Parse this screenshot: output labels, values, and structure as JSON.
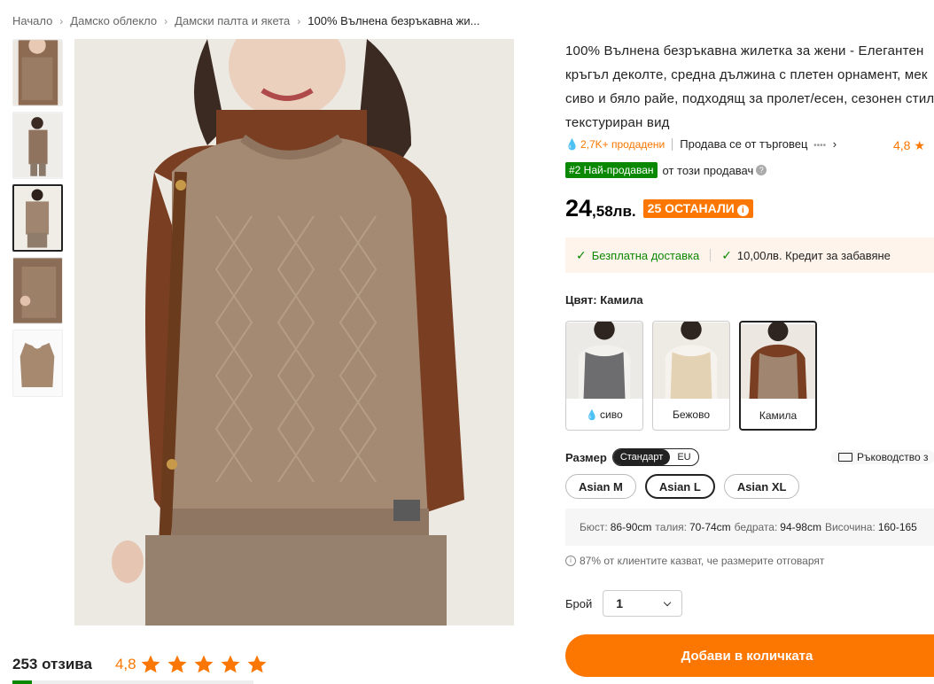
{
  "breadcrumb": [
    "Начало",
    "Дамско облекло",
    "Дамски палта и якета",
    "100% Вълнена безръкавна жи..."
  ],
  "product": {
    "title": "100% Вълнена безръкавна жилетка за жени - Елегантен кръгъл деколте, средна дължина с плетен орнамент, мек сиво и бяло райе, подходящ за пролет/есен, сезонен стил текстуриран вид",
    "sold": "2,7K+ продадени",
    "seller": "Продава се от търговец",
    "seller_masked": "••••",
    "rating_top": "4,8",
    "best_badge": "#2 Най-продаван",
    "best_text": "от този продавач",
    "price_int": "24",
    "price_dec": ",58лв.",
    "stock_badge": "25 ОСТАНАЛИ",
    "shipping_free": "Безплатна доставка",
    "credit": "10,00лв. Кредит за забавяне",
    "color_label": "Цвят: Камила",
    "colors": [
      {
        "label": "сиво",
        "hot": true
      },
      {
        "label": "Бежово",
        "hot": false
      },
      {
        "label": "Камила",
        "hot": false
      }
    ],
    "size_label": "Размер",
    "size_toggle": [
      "Стандарт",
      "EU"
    ],
    "size_guide": "Ръководство з",
    "sizes": [
      "Asian M",
      "Asian L",
      "Asian XL"
    ],
    "measure": {
      "bust_label": "Бюст:",
      "bust": "86-90cm",
      "waist_label": "талия:",
      "waist": "70-74cm",
      "hips_label": "бедрата:",
      "hips": "94-98cm",
      "height_label": "Височина:",
      "height": "160-165"
    },
    "fit_text": "87% от клиентите казват, че размерите отговарят",
    "qty_label": "Брой",
    "qty_value": "1",
    "add_to_cart": "Добави в количката"
  },
  "reviews": {
    "count": "253 отзива",
    "rating": "4,8"
  },
  "colors": {
    "accent": "#fb7701",
    "green": "#0a8800",
    "camel": "#a08670"
  }
}
